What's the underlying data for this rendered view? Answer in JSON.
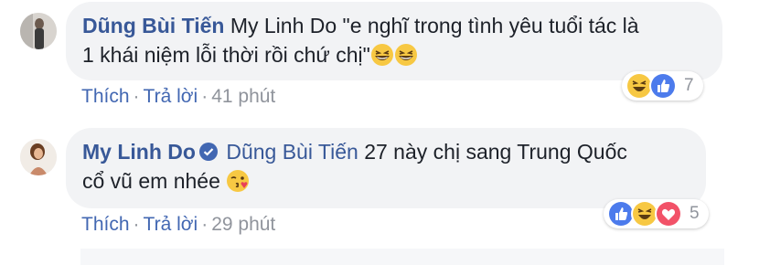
{
  "comments": [
    {
      "author": "Dũng Bùi Tiến",
      "mention": "",
      "line1": "My Linh Do \"e nghĩ trong tình yêu tuổi tác là",
      "line2": "1 khái niệm lỗi thời rồi chứ chị\"",
      "emoji": [
        "grinning-squint-emoji",
        "grinning-squint-emoji"
      ],
      "actions": {
        "like": "Thích",
        "reply": "Trả lời",
        "time": "41 phút"
      },
      "reactions": {
        "icons": [
          "haha-reaction-icon",
          "like-reaction-icon"
        ],
        "count": "7"
      }
    },
    {
      "author": "My Linh Do",
      "mention": "Dũng Bùi Tiến",
      "line1": "27 này chị sang Trung Quốc",
      "line2": "cổ vũ em nhée",
      "emoji": [
        "kissing-wink-emoji"
      ],
      "actions": {
        "like": "Thích",
        "reply": "Trả lời",
        "time": "29 phút"
      },
      "reactions": {
        "icons": [
          "like-reaction-icon",
          "haha-reaction-icon",
          "love-reaction-icon"
        ],
        "count": "5"
      }
    }
  ],
  "colors": {
    "link": "#385898",
    "action": "#4267b2",
    "meta": "#90949c",
    "bubble": "#f2f3f5"
  }
}
